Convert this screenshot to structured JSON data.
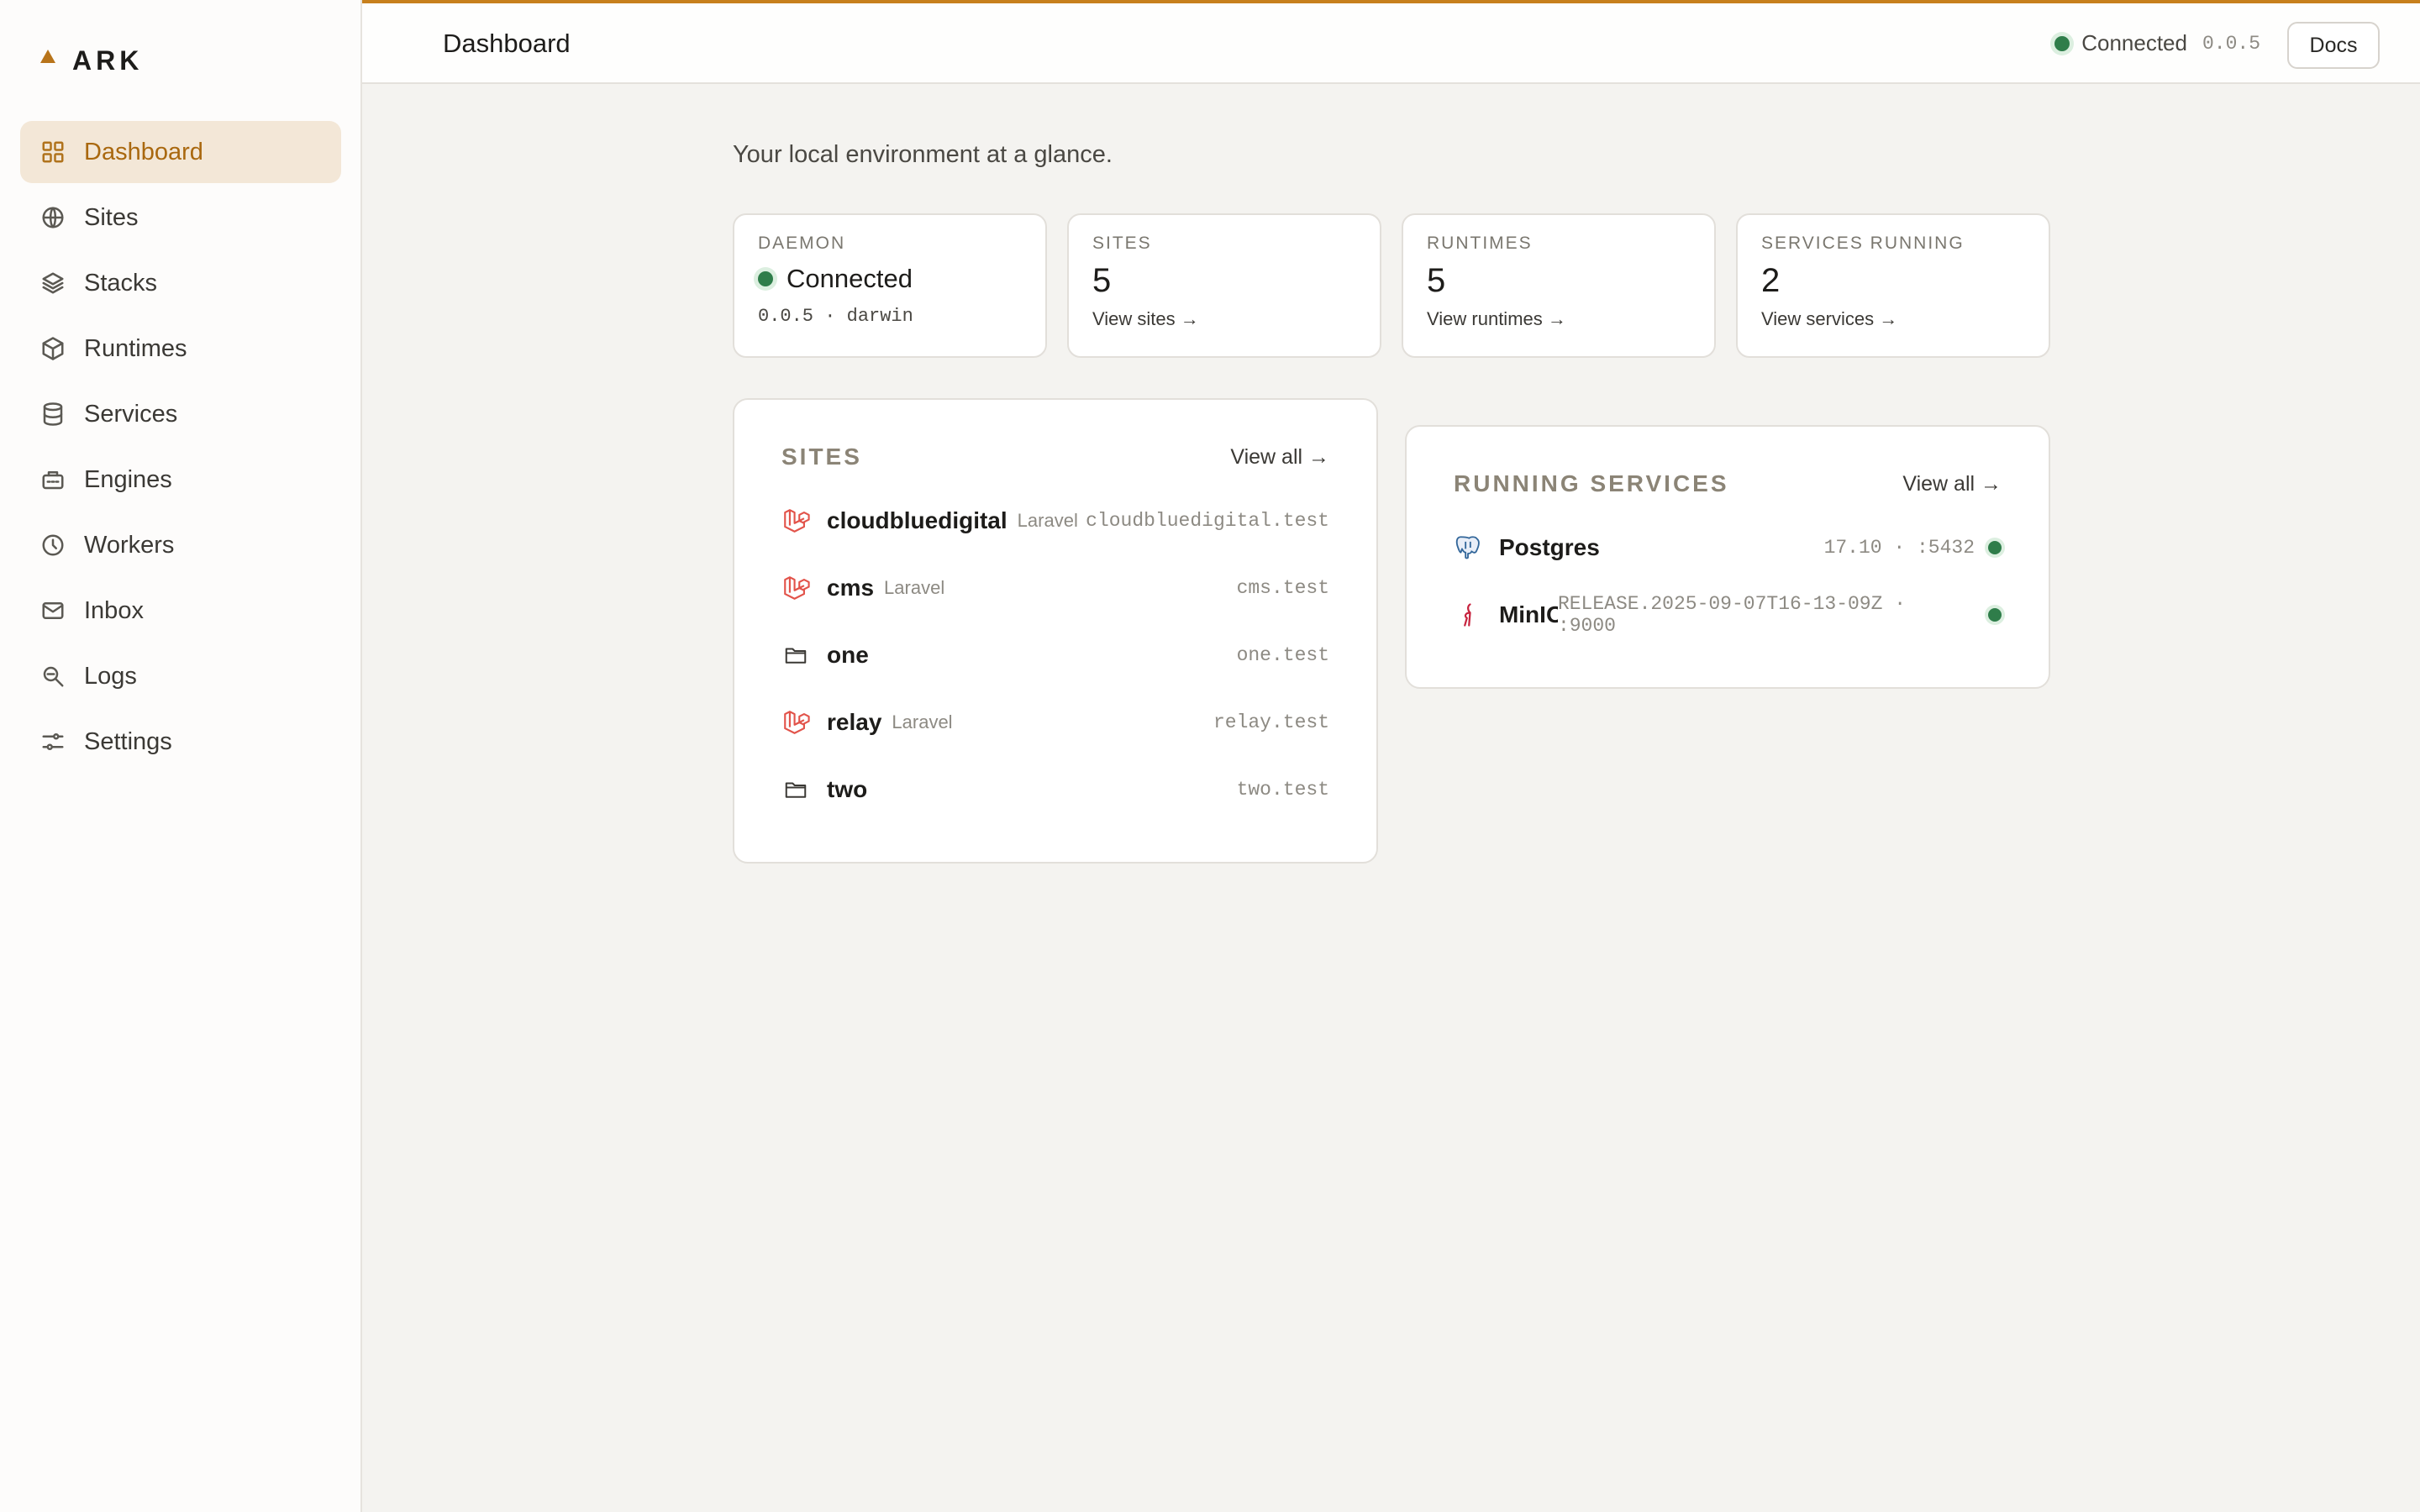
{
  "brand": {
    "name": "ARK"
  },
  "sidebar": {
    "items": [
      {
        "label": "Dashboard",
        "icon": "grid-icon",
        "active": true
      },
      {
        "label": "Sites",
        "icon": "globe-icon"
      },
      {
        "label": "Stacks",
        "icon": "layers-icon"
      },
      {
        "label": "Runtimes",
        "icon": "cube-icon"
      },
      {
        "label": "Services",
        "icon": "database-icon"
      },
      {
        "label": "Engines",
        "icon": "engine-icon"
      },
      {
        "label": "Workers",
        "icon": "clock-icon"
      },
      {
        "label": "Inbox",
        "icon": "mail-icon"
      },
      {
        "label": "Logs",
        "icon": "search-log-icon"
      },
      {
        "label": "Settings",
        "icon": "sliders-icon"
      }
    ]
  },
  "header": {
    "title": "Dashboard",
    "status": "Connected",
    "version": "0.0.5",
    "docs_label": "Docs"
  },
  "main": {
    "subtitle": "Your local environment at a glance.",
    "stats": {
      "daemon": {
        "label": "DAEMON",
        "value": "Connected",
        "sub": "0.0.5 · darwin"
      },
      "sites": {
        "label": "SITES",
        "value": "5",
        "link": "View sites →"
      },
      "runtimes": {
        "label": "RUNTIMES",
        "value": "5",
        "link": "View runtimes →"
      },
      "services": {
        "label": "SERVICES RUNNING",
        "value": "2",
        "link": "View services →"
      }
    },
    "sites_panel": {
      "title": "SITES",
      "view_all": "View all →",
      "rows": [
        {
          "name": "cloudbluedigital",
          "tag": "Laravel",
          "domain": "cloudbluedigital.test",
          "icon": "laravel-icon"
        },
        {
          "name": "cms",
          "tag": "Laravel",
          "domain": "cms.test",
          "icon": "laravel-icon"
        },
        {
          "name": "one",
          "tag": "",
          "domain": "one.test",
          "icon": "folder-icon"
        },
        {
          "name": "relay",
          "tag": "Laravel",
          "domain": "relay.test",
          "icon": "laravel-icon"
        },
        {
          "name": "two",
          "tag": "",
          "domain": "two.test",
          "icon": "folder-icon"
        }
      ]
    },
    "services_panel": {
      "title": "RUNNING SERVICES",
      "view_all": "View all →",
      "rows": [
        {
          "name": "Postgres",
          "detail": "17.10 · :5432",
          "icon": "postgres-icon"
        },
        {
          "name": "MinIO",
          "detail": "RELEASE.2025-09-07T16-13-09Z · :9000",
          "icon": "minio-icon"
        }
      ]
    }
  },
  "colors": {
    "accent": "#c7801d",
    "active_bg": "#f3e7d7",
    "status_green": "#2f7d4a"
  }
}
